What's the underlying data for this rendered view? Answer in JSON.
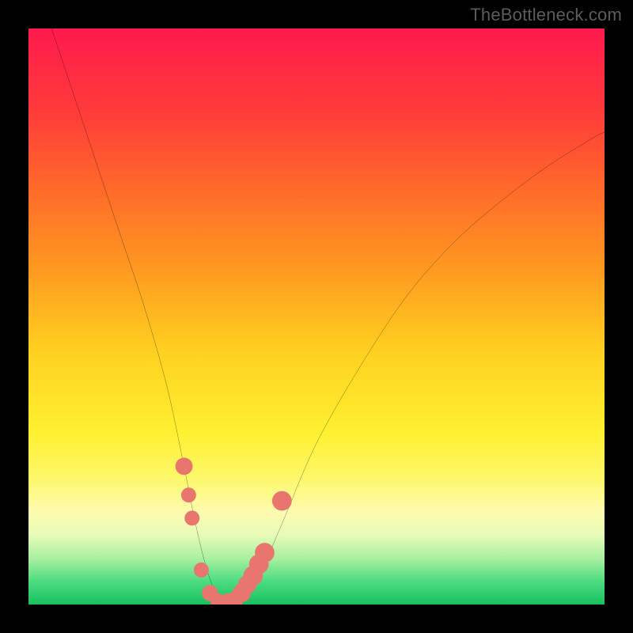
{
  "attribution": "TheBottleneck.com",
  "colors": {
    "frame": "#000000",
    "curve": "#000000",
    "marker": "#e9766e",
    "gradient_top": "#ff1a4d",
    "gradient_bottom": "#18c060"
  },
  "chart_data": {
    "type": "line",
    "title": "",
    "xlabel": "",
    "ylabel": "",
    "xlim": [
      0,
      100
    ],
    "ylim": [
      0,
      100
    ],
    "grid": false,
    "legend": false,
    "series": [
      {
        "name": "bottleneck-curve",
        "x": [
          4,
          8,
          12,
          16,
          20,
          24,
          27,
          29,
          31,
          33,
          35,
          37,
          40,
          44,
          50,
          58,
          66,
          74,
          82,
          90,
          98,
          100
        ],
        "y": [
          100,
          88,
          76,
          64,
          52,
          38,
          24,
          14,
          6,
          1,
          0,
          1,
          5,
          14,
          28,
          42,
          54,
          63,
          70,
          76,
          81,
          82
        ]
      }
    ],
    "markers": [
      {
        "x": 27.0,
        "y": 24,
        "r": 1.5
      },
      {
        "x": 27.8,
        "y": 19,
        "r": 1.3
      },
      {
        "x": 28.4,
        "y": 15,
        "r": 1.3
      },
      {
        "x": 30.0,
        "y": 6,
        "r": 1.3
      },
      {
        "x": 31.5,
        "y": 2,
        "r": 1.4
      },
      {
        "x": 33.0,
        "y": 0.5,
        "r": 1.4
      },
      {
        "x": 34.5,
        "y": 0.5,
        "r": 1.4
      },
      {
        "x": 36.0,
        "y": 1,
        "r": 1.4
      },
      {
        "x": 37.0,
        "y": 2,
        "r": 1.6
      },
      {
        "x": 38.0,
        "y": 3.5,
        "r": 1.6
      },
      {
        "x": 39.0,
        "y": 5,
        "r": 1.7
      },
      {
        "x": 40.0,
        "y": 7,
        "r": 1.7
      },
      {
        "x": 41.0,
        "y": 9,
        "r": 1.7
      },
      {
        "x": 44.0,
        "y": 18,
        "r": 1.7
      }
    ]
  }
}
